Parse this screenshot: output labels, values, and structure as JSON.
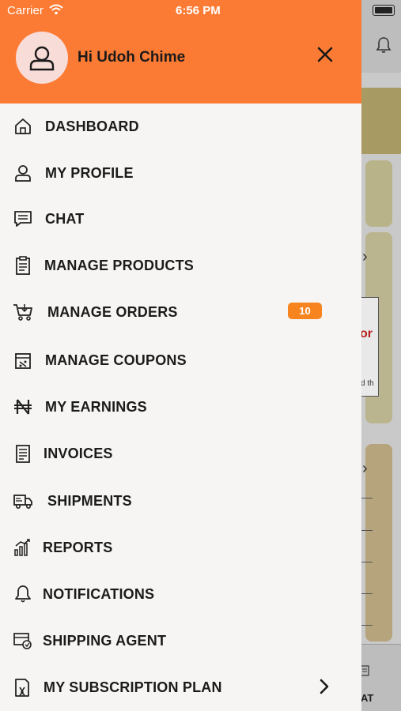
{
  "status_bar": {
    "carrier": "Carrier",
    "time": "6:56 PM"
  },
  "header": {
    "greeting": "Hi Udoh Chime"
  },
  "menu": {
    "items": [
      {
        "label": "DASHBOARD",
        "icon": "home-icon"
      },
      {
        "label": "MY PROFILE",
        "icon": "user-icon"
      },
      {
        "label": "CHAT",
        "icon": "chat-icon"
      },
      {
        "label": "MANAGE PRODUCTS",
        "icon": "clipboard-icon"
      },
      {
        "label": "MANAGE ORDERS",
        "icon": "cart-icon",
        "badge": "10"
      },
      {
        "label": "MANAGE COUPONS",
        "icon": "coupon-icon"
      },
      {
        "label": "MY EARNINGS",
        "icon": "naira-icon"
      },
      {
        "label": "INVOICES",
        "icon": "invoice-icon"
      },
      {
        "label": "SHIPMENTS",
        "icon": "truck-icon"
      },
      {
        "label": "REPORTS",
        "icon": "bar-chart-icon"
      },
      {
        "label": "NOTIFICATIONS",
        "icon": "bell-icon"
      },
      {
        "label": "SHIPPING AGENT",
        "icon": "shipping-agent-icon"
      },
      {
        "label": "MY SUBSCRIPTION PLAN",
        "icon": "subscription-icon"
      }
    ]
  },
  "background": {
    "tab_label": "AT",
    "promo_text": "or",
    "promo_sub": "d th"
  },
  "colors": {
    "accent": "#fc7b34",
    "badge": "#f7841e",
    "drawer_bg": "#f6f5f3"
  }
}
